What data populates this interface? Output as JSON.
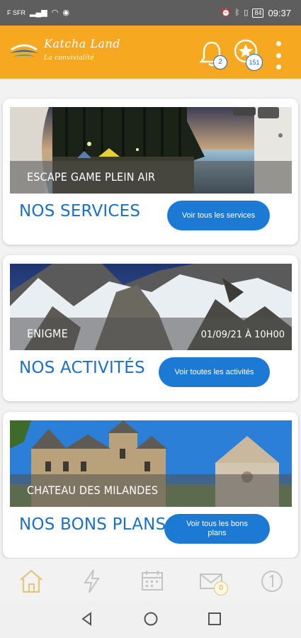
{
  "status_bar": {
    "carrier": "F SFR",
    "battery": "84",
    "time": "09:37"
  },
  "header": {
    "brand_name": "Katcha Land",
    "tagline": "La convivialité",
    "notifications_count": "2",
    "favorites_count": "151"
  },
  "cards": [
    {
      "image_caption": "ESCAPE GAME PLEIN AIR",
      "date": "",
      "title": "NOS SERVICES",
      "button_label": "Voir tous les services"
    },
    {
      "image_caption": "ENIGME",
      "date": "01/09/21 À 10H00",
      "title": "NOS ACTIVITÉS",
      "button_label": "Voir toutes les activités"
    },
    {
      "image_caption": "CHATEAU DES MILANDES",
      "date": "",
      "title": "NOS BONS PLANS",
      "button_label": "Voir tous les bons plans"
    }
  ],
  "tab_bar": {
    "messages_count": "0"
  },
  "colors": {
    "accent": "#f5a820",
    "primary": "#1d7ad4",
    "title_blue": "#1d6fc4",
    "status_bar": "#5e5e5e"
  },
  "icons": [
    "home-icon",
    "bolt-icon",
    "calendar-icon",
    "mail-icon",
    "info-icon",
    "bell-icon",
    "star-icon",
    "more-vert-icon"
  ]
}
